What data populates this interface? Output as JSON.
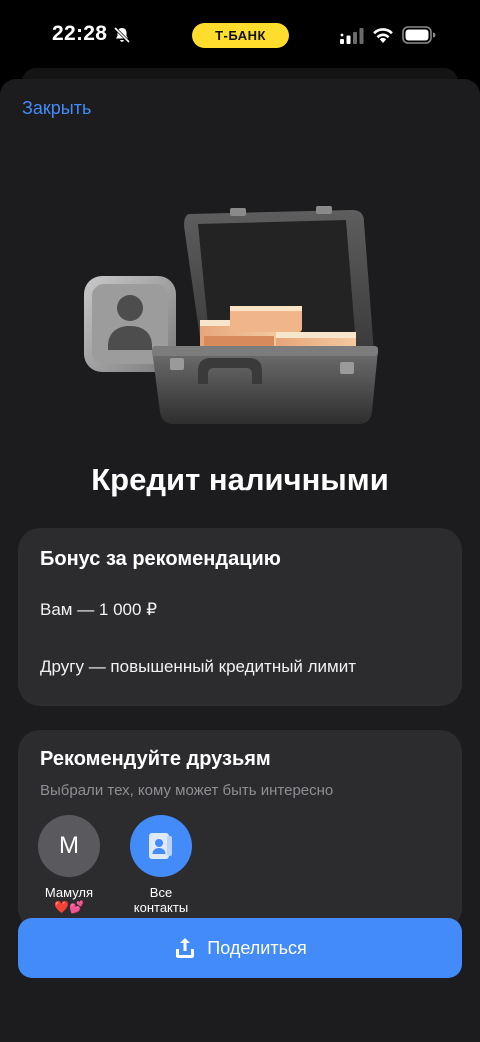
{
  "status_bar": {
    "time": "22:28",
    "bank_label": "Т-БАНК",
    "icons": [
      "bell-off-icon",
      "signal-icon",
      "wifi-icon",
      "battery-icon"
    ]
  },
  "header": {
    "close_label": "Закрыть"
  },
  "hero": {
    "illustration": "briefcase-with-money"
  },
  "title": "Кредит наличными",
  "bonus_card": {
    "title": "Бонус за рекомендацию",
    "you": "Вам — 1 000 ₽",
    "friend": "Другу — повышенный кредитный лимит"
  },
  "friends_card": {
    "title": "Рекомендуйте друзьям",
    "subtitle": "Выбрали тех, кому может быть интересно",
    "contacts": [
      {
        "initial": "М",
        "name": "Мамуля",
        "emoji": "❤️💕"
      },
      {
        "name_line1": "Все",
        "name_line2": "контакты",
        "icon": "contacts-book-icon"
      }
    ]
  },
  "share_button": {
    "label": "Поделиться",
    "icon": "share-upload-icon"
  },
  "colors": {
    "accent": "#428bf9",
    "bank_yellow": "#ffdd2d",
    "card": "#2c2c2e",
    "sheet": "#1c1c1e"
  }
}
